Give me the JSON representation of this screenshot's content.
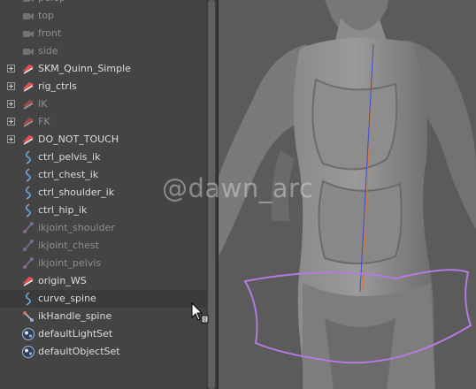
{
  "outliner": {
    "items": [
      {
        "label": "persp",
        "icon": "camera-icon",
        "dim": true,
        "expandable": false
      },
      {
        "label": "top",
        "icon": "camera-icon",
        "dim": true,
        "expandable": false
      },
      {
        "label": "front",
        "icon": "camera-icon",
        "dim": true,
        "expandable": false
      },
      {
        "label": "side",
        "icon": "camera-icon",
        "dim": true,
        "expandable": false
      },
      {
        "label": "SKM_Quinn_Simple",
        "icon": "group-icon",
        "dim": false,
        "expandable": true
      },
      {
        "label": "rig_ctrls",
        "icon": "group-icon",
        "dim": false,
        "expandable": true
      },
      {
        "label": "IK",
        "icon": "group-icon",
        "dim": true,
        "expandable": true
      },
      {
        "label": "FK",
        "icon": "group-icon",
        "dim": true,
        "expandable": true
      },
      {
        "label": "DO_NOT_TOUCH",
        "icon": "group-icon",
        "dim": false,
        "expandable": true
      },
      {
        "label": "ctrl_pelvis_ik",
        "icon": "curve-icon",
        "dim": false,
        "expandable": false
      },
      {
        "label": "ctrl_chest_ik",
        "icon": "curve-icon",
        "dim": false,
        "expandable": false
      },
      {
        "label": "ctrl_shoulder_ik",
        "icon": "curve-icon",
        "dim": false,
        "expandable": false
      },
      {
        "label": "ctrl_hip_ik",
        "icon": "curve-icon",
        "dim": false,
        "expandable": false
      },
      {
        "label": "ikjoint_shoulder",
        "icon": "joint-icon",
        "dim": true,
        "expandable": false
      },
      {
        "label": "ikjoint_chest",
        "icon": "joint-icon",
        "dim": true,
        "expandable": false
      },
      {
        "label": "ikjoint_pelvis",
        "icon": "joint-icon",
        "dim": true,
        "expandable": false
      },
      {
        "label": "origin_WS",
        "icon": "group-icon",
        "dim": false,
        "expandable": false
      },
      {
        "label": "curve_spine",
        "icon": "curve-icon",
        "dim": false,
        "expandable": false,
        "selected": true
      },
      {
        "label": "ikHandle_spine",
        "icon": "ik-handle-icon",
        "dim": false,
        "expandable": false
      },
      {
        "label": "defaultLightSet",
        "icon": "set-icon",
        "dim": false,
        "expandable": false
      },
      {
        "label": "defaultObjectSet",
        "icon": "set-icon",
        "dim": false,
        "expandable": false
      }
    ]
  },
  "viewport": {
    "watermark": "@dawn_arc",
    "curve_color": "#b57ae0"
  },
  "colors": {
    "panel_bg": "#444444",
    "text": "#dcdcdc",
    "text_dim": "#8e8e8e",
    "group_icon": "#e05050",
    "curve_icon": "#6fa8dc",
    "joint_icon": "#b48ad8"
  }
}
